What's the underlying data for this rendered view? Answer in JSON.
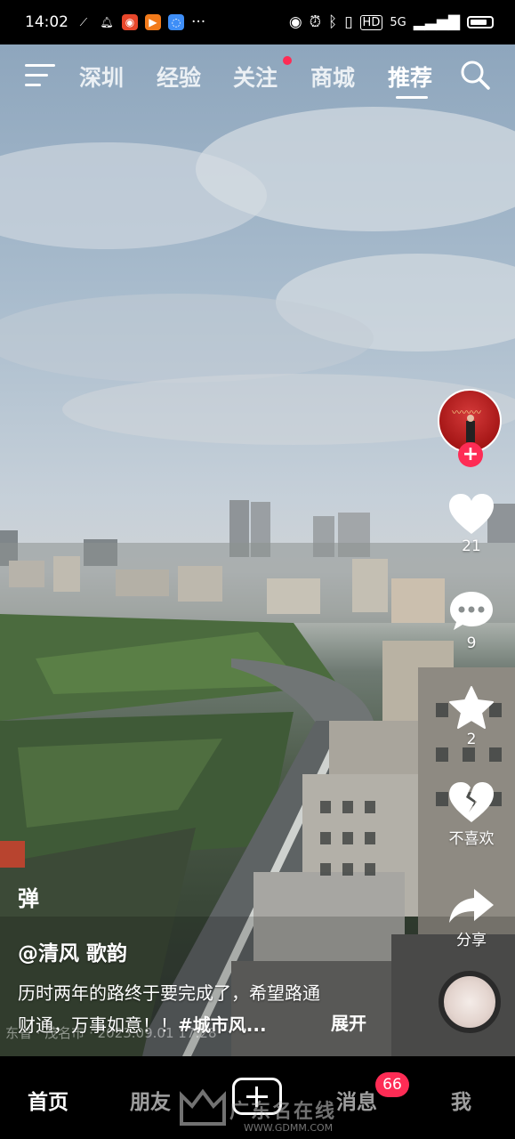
{
  "status_bar": {
    "time": "14:02",
    "dots": "···",
    "hd": "HD",
    "signal": "5G"
  },
  "top_nav": {
    "tabs": [
      {
        "label": "深圳",
        "active": false
      },
      {
        "label": "经验",
        "active": false
      },
      {
        "label": "关注",
        "active": false
      },
      {
        "label": "商城",
        "active": false
      },
      {
        "label": "推荐",
        "active": true
      }
    ]
  },
  "actions": {
    "like_count": "21",
    "comment_count": "9",
    "favorite_count": "2",
    "dislike_label": "不喜欢",
    "share_label": "分享",
    "follow_symbol": "+"
  },
  "danmu_label": "弹",
  "video": {
    "author": "@清风  歌韵",
    "description_line1": "历时两年的路终于要完成了，希望路通",
    "description_line2_text": "财通，万事如意！！",
    "description_tag": "#城市风...",
    "expand_label": "展开",
    "location": "东省 · 茂名市 · 2023.09.01 17:28"
  },
  "bottom_nav": {
    "tabs": [
      {
        "label": "首页",
        "active": true
      },
      {
        "label": "朋友",
        "active": false
      },
      {
        "label": "消息",
        "active": false
      },
      {
        "label": "我",
        "active": false
      }
    ],
    "messages_badge": "66"
  },
  "watermark": {
    "text": "广东名在线",
    "url": "WWW.GDMM.COM"
  }
}
